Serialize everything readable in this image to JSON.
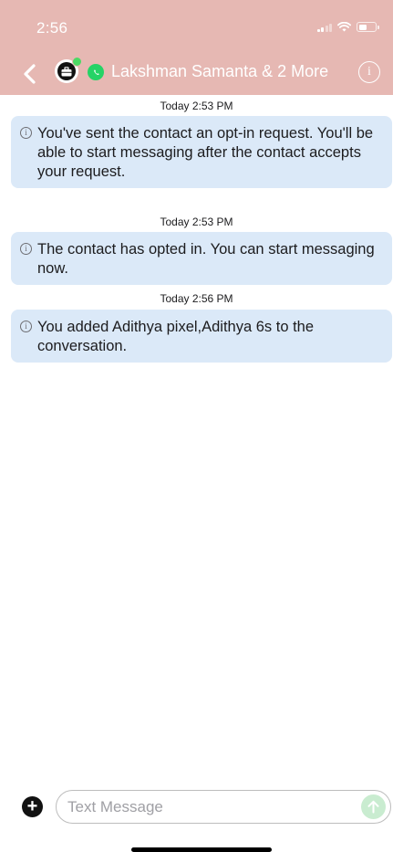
{
  "status_bar": {
    "time": "2:56"
  },
  "nav": {
    "title": "Lakshman Samanta & 2 More",
    "info_symbol": "i",
    "back_icon": "chevron-left-icon",
    "avatar_icon": "briefcase-icon",
    "channel_icon": "whatsapp-icon"
  },
  "messages": [
    {
      "timestamp": "Today 2:53 PM",
      "text": "You've sent the contact an opt-in request. You'll be able to start messaging after the contact accepts your request."
    },
    {
      "timestamp": "Today 2:53 PM",
      "text": "The contact has opted in. You can start messaging now."
    },
    {
      "timestamp": "Today 2:56 PM",
      "text": "You added Adithya pixel,Adithya 6s to the conversation."
    }
  ],
  "composer": {
    "placeholder": "Text Message",
    "value": "",
    "add_symbol": "+",
    "send_icon": "arrow-up-icon"
  },
  "colors": {
    "header_bg": "#e6b8b3",
    "system_message_bg": "#dbe9f8",
    "presence": "#4cd964",
    "whatsapp": "#25d366",
    "send_button": "#c9ecd0"
  },
  "info_glyph": "i"
}
